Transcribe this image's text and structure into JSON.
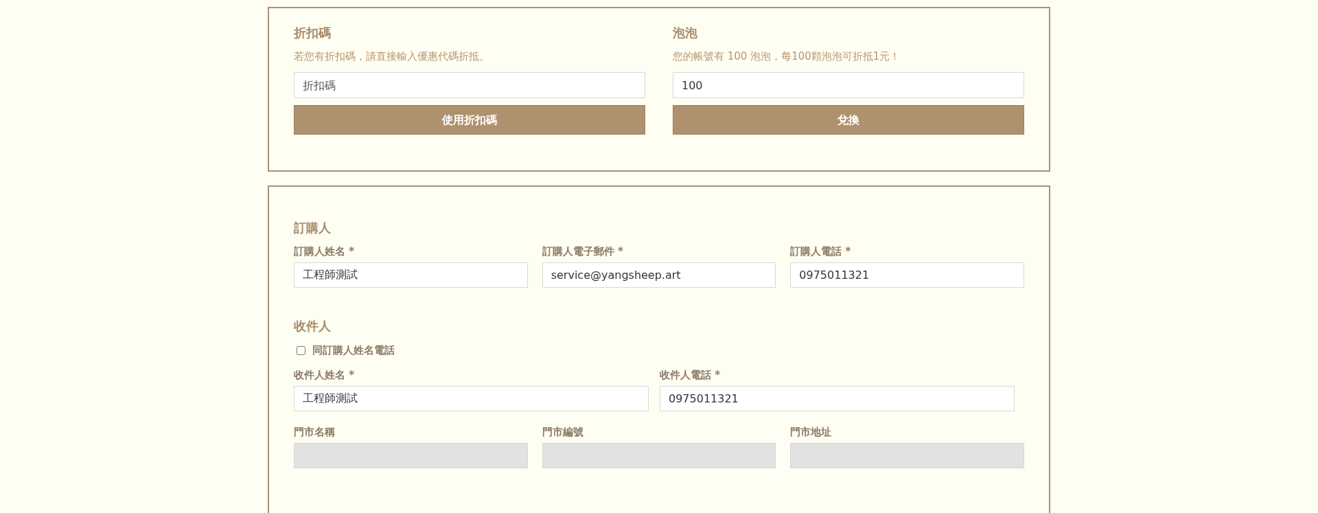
{
  "discount": {
    "title": "折扣碼",
    "description": "若您有折扣碼，請直接輸入優惠代碼折抵。",
    "field": {
      "placeholder": "折扣碼"
    },
    "button": "使用折扣碼"
  },
  "bubbles": {
    "title": "泡泡",
    "description": "您的帳號有 100 泡泡，每100顆泡泡可折抵1元！",
    "field": {
      "value": "100"
    },
    "button": "兌換"
  },
  "orderer": {
    "title": "訂購人",
    "fields": [
      {
        "label": "訂購人姓名 *",
        "value": "工程師測試",
        "disabled": false
      },
      {
        "label": "訂購人電子郵件 *",
        "value": "service@yangsheep.art",
        "disabled": false
      },
      {
        "label": "訂購人電話 *",
        "value": "0975011321",
        "disabled": false
      }
    ]
  },
  "recipient": {
    "title": "收件人",
    "same_as_orderer": {
      "label": "同訂購人姓名電話",
      "checked": false
    },
    "fields": [
      {
        "label": "收件人姓名 *",
        "value": "工程師測試",
        "disabled": false
      },
      {
        "label": "收件人電話 *",
        "value": "0975011321",
        "disabled": false
      }
    ],
    "store_fields": [
      {
        "label": "門市名稱",
        "disabled": true
      },
      {
        "label": "門市編號",
        "disabled": true
      },
      {
        "label": "門市地址",
        "disabled": true
      }
    ]
  }
}
